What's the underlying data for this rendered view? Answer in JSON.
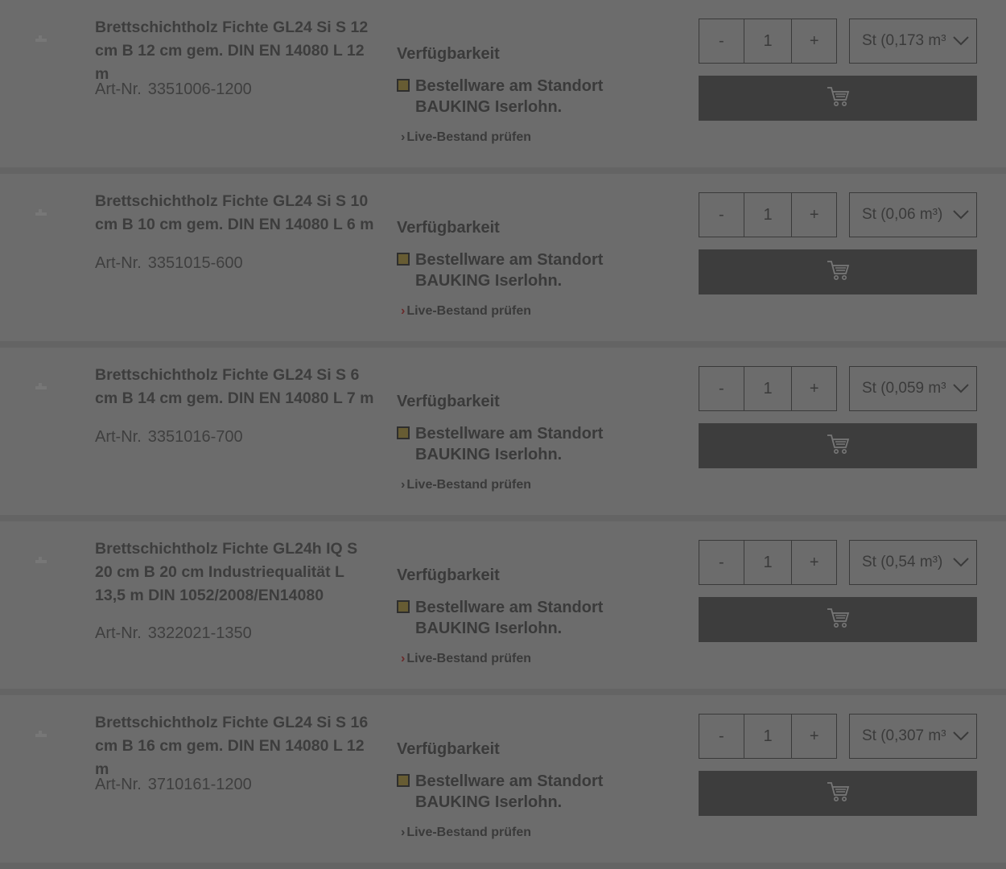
{
  "common": {
    "availability_label": "Verfügbarkeit",
    "stock_status": "Bestellware am Standort BAUKING Iserlohn.",
    "live_stock_link": "Live-Bestand prüfen",
    "art_nr_label": "Art-Nr.",
    "minus_label": "-",
    "plus_label": "+",
    "colors": {
      "overlay_bg": "#6c6c6c",
      "cart_button": "#3d3d3d",
      "stock_indicator": "#675c33",
      "link_chevron_red": "#6b2a2a"
    }
  },
  "products": [
    {
      "title": "Brettschichtholz Fichte GL24 Si S 12 cm B 12 cm gem. DIN EN 14080 L 12 m",
      "art_nr": "3351006-1200",
      "quantity": "1",
      "unit": "St (0,173 m³)"
    },
    {
      "title": "Brettschichtholz Fichte GL24 Si S 10 cm B 10 cm gem. DIN EN 14080 L 6 m",
      "art_nr": "3351015-600",
      "quantity": "1",
      "unit": "St (0,06 m³)"
    },
    {
      "title": "Brettschichtholz Fichte GL24 Si S 6 cm B 14 cm gem. DIN EN 14080 L 7 m",
      "art_nr": "3351016-700",
      "quantity": "1",
      "unit": "St (0,059 m³)"
    },
    {
      "title": "Brettschichtholz Fichte GL24h IQ S 20 cm B 20 cm Industriequalität L 13,5 m DIN 1052/2008/EN14080",
      "art_nr": "3322021-1350",
      "quantity": "1",
      "unit": "St (0,54 m³)"
    },
    {
      "title": "Brettschichtholz Fichte GL24 Si S 16 cm B 16 cm gem. DIN EN 14080 L 12 m",
      "art_nr": "3710161-1200",
      "quantity": "1",
      "unit": "St (0,307 m³)"
    }
  ]
}
